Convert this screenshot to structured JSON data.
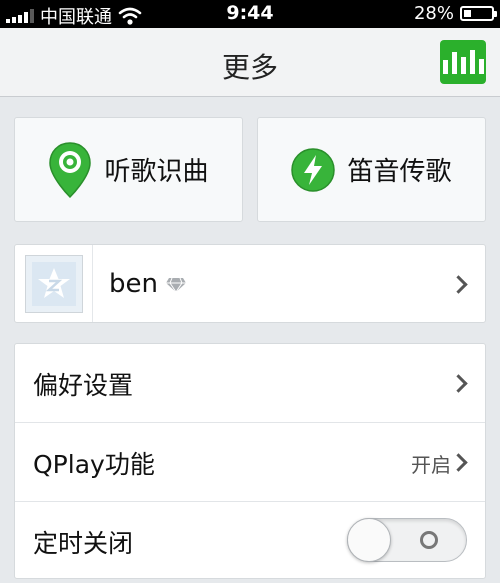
{
  "status_bar": {
    "carrier": "中国联通",
    "time": "9:44",
    "battery": "28%",
    "battery_level": 0.28
  },
  "nav": {
    "title": "更多",
    "right_icon": "equalizer-icon"
  },
  "features": [
    {
      "label": "听歌识曲",
      "icon": "location-pin-icon"
    },
    {
      "label": "笛音传歌",
      "icon": "lightning-icon"
    }
  ],
  "profile": {
    "username": "ben",
    "badge_icon": "diamond-icon"
  },
  "settings": [
    {
      "label": "偏好设置",
      "value": "",
      "control": "chevron"
    },
    {
      "label": "QPlay功能",
      "value": "开启",
      "control": "chevron"
    },
    {
      "label": "定时关闭",
      "value": "",
      "control": "toggle",
      "on": false
    }
  ],
  "colors": {
    "accent_green": "#2bb02c",
    "background": "#e6e9ec"
  }
}
